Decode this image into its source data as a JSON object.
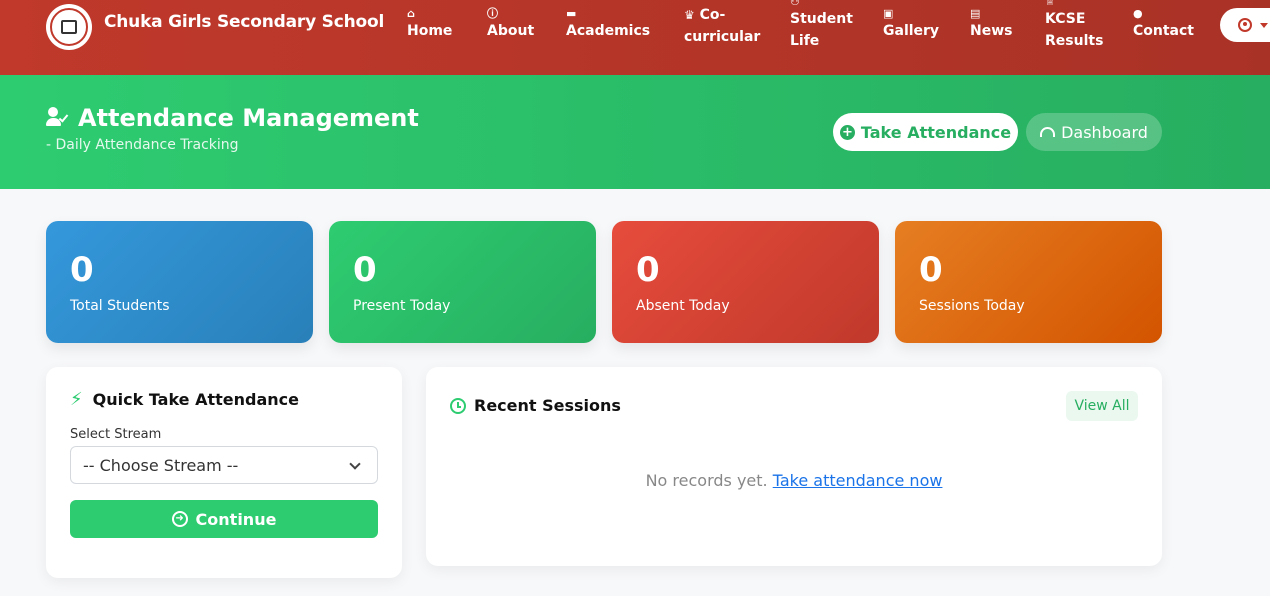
{
  "navbar": {
    "brand": "Chuka Girls Secondary School",
    "logo_icon": "school-crest-icon",
    "items": [
      {
        "label": "Home",
        "icon": "home-icon"
      },
      {
        "label": "About",
        "icon": "info-icon"
      },
      {
        "label": "Academics",
        "icon": "book-icon"
      },
      {
        "label": "Co-\ncurricular",
        "label_line1": "Co-",
        "label_line2": "curricular",
        "icon": "trophy-icon"
      },
      {
        "label_line1": "Student",
        "label_line2": "Life",
        "icon": "users-icon"
      },
      {
        "label": "Gallery",
        "icon": "image-icon"
      },
      {
        "label": "News",
        "icon": "newspaper-icon"
      },
      {
        "label_line1": "KCSE",
        "label_line2": "Results",
        "icon": "award-icon"
      },
      {
        "label": "Contact",
        "icon": "chat-icon"
      }
    ],
    "account_icon": "user-circle-icon"
  },
  "hero": {
    "title": "Attendance Management",
    "subtitle": "- Daily Attendance Tracking",
    "take_attendance": "Take Attendance",
    "dashboard": "Dashboard"
  },
  "stats": [
    {
      "value": "0",
      "label": "Total Students",
      "color": "#3498db"
    },
    {
      "value": "0",
      "label": "Present Today",
      "color": "#2ecc71"
    },
    {
      "value": "0",
      "label": "Absent Today",
      "color": "#e74c3c"
    },
    {
      "value": "0",
      "label": "Sessions Today",
      "color": "#e67e22"
    }
  ],
  "quick": {
    "title": "Quick Take Attendance",
    "stream_label": "Select Stream",
    "stream_placeholder": "-- Choose Stream --",
    "continue": "Continue"
  },
  "recent": {
    "title": "Recent Sessions",
    "view_all": "View All",
    "empty_text": "No records yet.",
    "empty_link": "Take attendance now"
  },
  "colors": {
    "navbar": "#c0392b",
    "hero": "#2ecc71",
    "accent_green": "#27ae60",
    "link": "#1a73e8"
  }
}
